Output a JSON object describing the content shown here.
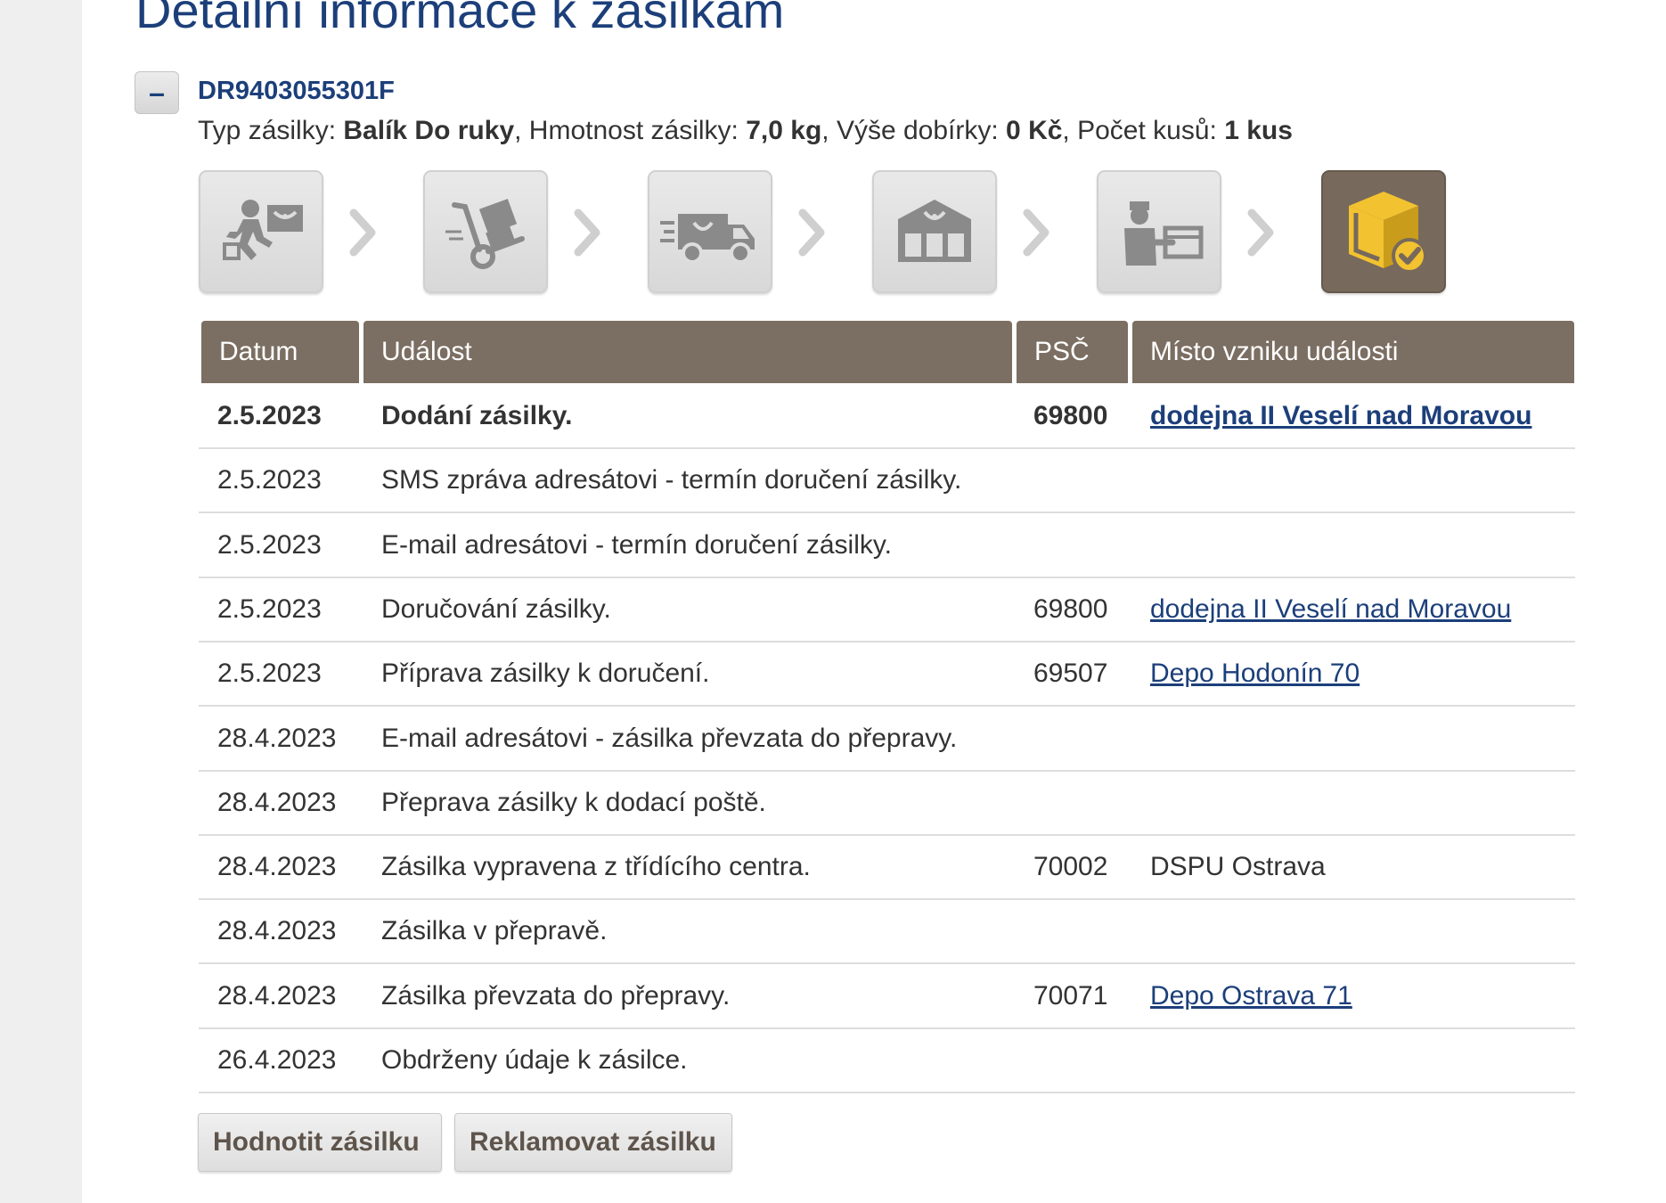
{
  "page": {
    "title": "Detailní informace k zásilkám"
  },
  "parcel": {
    "toggle_symbol": "–",
    "id": "DR9403055301F",
    "type_label": "Typ zásilky:",
    "type_value": "Balík Do ruky",
    "weight_label": "Hmotnost zásilky:",
    "weight_value": "7,0 kg",
    "cod_label": "Výše dobírky:",
    "cod_value": "0 Kč",
    "count_label": "Počet kusů:",
    "count_value": "1 kus"
  },
  "steps": [
    {
      "icon": "courier-pickup-icon",
      "active": false
    },
    {
      "icon": "hand-truck-icon",
      "active": false
    },
    {
      "icon": "delivery-truck-icon",
      "active": false
    },
    {
      "icon": "post-office-icon",
      "active": false
    },
    {
      "icon": "courier-handover-icon",
      "active": false
    },
    {
      "icon": "delivered-box-icon",
      "active": true
    }
  ],
  "table": {
    "headers": {
      "date": "Datum",
      "event": "Událost",
      "psc": "PSČ",
      "place": "Místo vzniku události"
    },
    "rows": [
      {
        "date": "2.5.2023",
        "event": "Dodání zásilky.",
        "psc": "69800",
        "place": "dodejna II Veselí nad Moravou",
        "place_is_link": true,
        "bold": true
      },
      {
        "date": "2.5.2023",
        "event": "SMS zpráva adresátovi - termín doručení zásilky.",
        "psc": "",
        "place": "",
        "place_is_link": false,
        "bold": false
      },
      {
        "date": "2.5.2023",
        "event": "E-mail adresátovi - termín doručení zásilky.",
        "psc": "",
        "place": "",
        "place_is_link": false,
        "bold": false
      },
      {
        "date": "2.5.2023",
        "event": "Doručování zásilky.",
        "psc": "69800",
        "place": "dodejna II Veselí nad Moravou",
        "place_is_link": true,
        "bold": false
      },
      {
        "date": "2.5.2023",
        "event": "Příprava zásilky k doručení.",
        "psc": "69507",
        "place": "Depo Hodonín 70",
        "place_is_link": true,
        "bold": false
      },
      {
        "date": "28.4.2023",
        "event": "E-mail adresátovi - zásilka převzata do přepravy.",
        "psc": "",
        "place": "",
        "place_is_link": false,
        "bold": false
      },
      {
        "date": "28.4.2023",
        "event": "Přeprava zásilky k dodací poště.",
        "psc": "",
        "place": "",
        "place_is_link": false,
        "bold": false
      },
      {
        "date": "28.4.2023",
        "event": "Zásilka vypravena z třídícího centra.",
        "psc": "70002",
        "place": "DSPU Ostrava",
        "place_is_link": false,
        "bold": false
      },
      {
        "date": "28.4.2023",
        "event": "Zásilka v přepravě.",
        "psc": "",
        "place": "",
        "place_is_link": false,
        "bold": false
      },
      {
        "date": "28.4.2023",
        "event": "Zásilka převzata do přepravy.",
        "psc": "70071",
        "place": "Depo Ostrava 71",
        "place_is_link": true,
        "bold": false
      },
      {
        "date": "26.4.2023",
        "event": "Obdrženy údaje k zásilce.",
        "psc": "",
        "place": "",
        "place_is_link": false,
        "bold": false
      }
    ]
  },
  "actions": {
    "rate": "Hodnotit zásilku",
    "complain": "Reklamovat zásilku"
  },
  "colors": {
    "title_blue": "#1c3f7a",
    "header_brown": "#7b6e62",
    "active_step": "#77695c",
    "accent_yellow": "#f2c230"
  }
}
